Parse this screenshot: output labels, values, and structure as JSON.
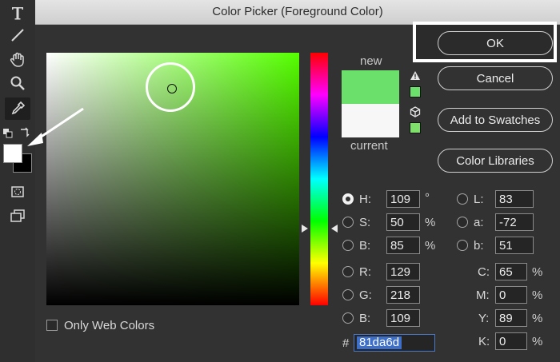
{
  "window": {
    "title": "Color Picker (Foreground Color)"
  },
  "toolbar": {
    "tools": [
      {
        "name": "type-tool-icon"
      },
      {
        "name": "line-tool-icon"
      },
      {
        "name": "hand-tool-icon"
      },
      {
        "name": "zoom-tool-icon"
      },
      {
        "name": "eyedropper-tool-icon"
      }
    ],
    "foreground_color": "#ffffff",
    "background_color": "#000000"
  },
  "preview": {
    "new_label": "new",
    "current_label": "current",
    "new_color": "#6be06b",
    "current_color": "#f7f7f7",
    "warning_icon": "gamut-warning-icon",
    "web_icon": "web-safe-cube-icon"
  },
  "buttons": {
    "ok": "OK",
    "cancel": "Cancel",
    "add_to_swatches": "Add to Swatches",
    "color_libraries": "Color Libraries"
  },
  "hsb": {
    "h": {
      "label": "H:",
      "value": "109",
      "unit": "°",
      "selected": true
    },
    "s": {
      "label": "S:",
      "value": "50",
      "unit": "%"
    },
    "b": {
      "label": "B:",
      "value": "85",
      "unit": "%"
    }
  },
  "rgb": {
    "r": {
      "label": "R:",
      "value": "129"
    },
    "g": {
      "label": "G:",
      "value": "218"
    },
    "b": {
      "label": "B:",
      "value": "109"
    }
  },
  "lab": {
    "l": {
      "label": "L:",
      "value": "83"
    },
    "a": {
      "label": "a:",
      "value": "-72"
    },
    "b": {
      "label": "b:",
      "value": "51"
    }
  },
  "cmyk": {
    "c": {
      "label": "C:",
      "value": "65",
      "unit": "%"
    },
    "m": {
      "label": "M:",
      "value": "0",
      "unit": "%"
    },
    "y": {
      "label": "Y:",
      "value": "89",
      "unit": "%"
    },
    "k": {
      "label": "K:",
      "value": "0",
      "unit": "%"
    }
  },
  "hex": {
    "label": "#",
    "value": "81da6d"
  },
  "web_only": {
    "label": "Only Web Colors",
    "checked": false
  },
  "colors": {
    "hue_color": "#55ff00",
    "accent": "#3d6ec8"
  }
}
